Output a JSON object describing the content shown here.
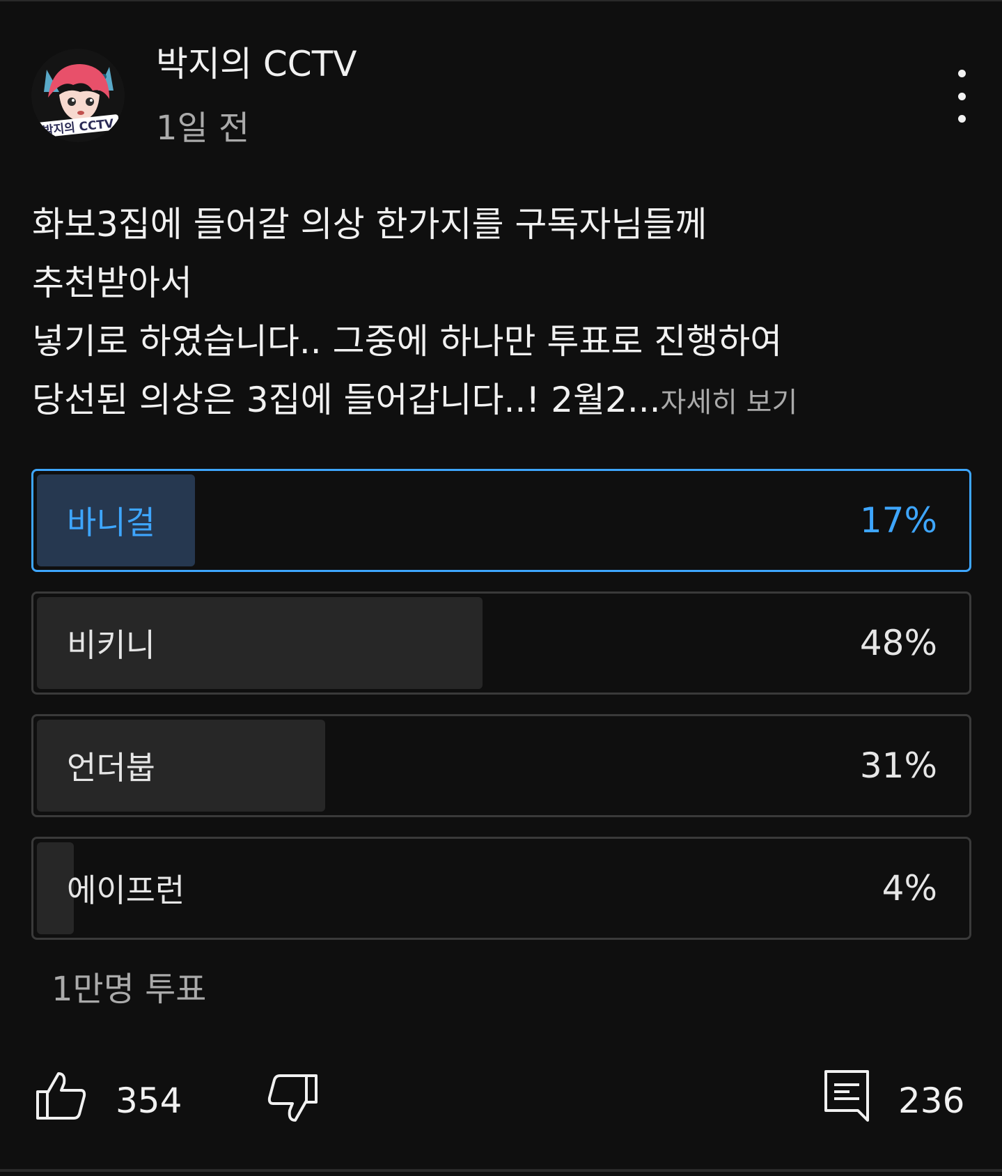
{
  "post": {
    "channel_name": "박지의 CCTV",
    "time_ago": "1일 전",
    "avatar_text": "박지의 CCTV",
    "body_lines": [
      "화보3집에 들어갈 의상 한가지를 구독자님들께",
      "추천받아서",
      "넣기로 하였습니다.. 그중에 하나만 투표로 진행하여",
      "당선된 의상은 3집에 들어갑니다..! 2월2..."
    ],
    "read_more": "자세히 보기"
  },
  "poll": {
    "options": [
      {
        "label": "바니걸",
        "percent_text": "17%",
        "percent": 17,
        "selected": true
      },
      {
        "label": "비키니",
        "percent_text": "48%",
        "percent": 48,
        "selected": false
      },
      {
        "label": "언더붑",
        "percent_text": "31%",
        "percent": 31,
        "selected": false
      },
      {
        "label": "에이프런",
        "percent_text": "4%",
        "percent": 4,
        "selected": false
      }
    ],
    "vote_count": "1만명 투표"
  },
  "actions": {
    "like_icon": "thumbs-up-icon",
    "like_count": "354",
    "dislike_icon": "thumbs-down-icon",
    "comment_icon": "comment-icon",
    "comment_count": "236"
  },
  "colors": {
    "background": "#0f0f0f",
    "accent": "#3ea6ff",
    "selected_fill": "#263850",
    "option_fill": "#272727"
  }
}
